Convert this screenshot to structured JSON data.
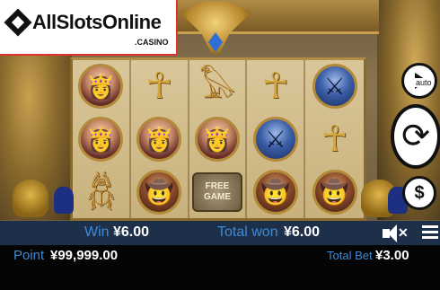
{
  "logo": {
    "text": "AllSlotsOnline",
    "sub": ".CASINO"
  },
  "reels": [
    [
      "queen",
      "ankh",
      "bird",
      "ankh",
      "warrior"
    ],
    [
      "queen",
      "queen",
      "queen",
      "warrior",
      "ankh"
    ],
    [
      "scarab-scroll",
      "explorer",
      "free",
      "explorer",
      "explorer"
    ]
  ],
  "free_symbol": {
    "line1": "FREE",
    "line2": "GAME"
  },
  "buttons": {
    "auto_label": "auto",
    "spin_icon": "refresh-icon",
    "bet_icon": "dollar-icon",
    "bet_glyph": "$"
  },
  "win_bar": {
    "win_label": "Win",
    "win_value": "¥6.00",
    "total_won_label": "Total won",
    "total_won_value": "¥6.00",
    "sound_icon": "speaker-muted-icon",
    "menu_icon": "hamburger-menu-icon"
  },
  "stats_bar": {
    "point_label": "Point",
    "point_value": "¥99,999.00",
    "total_bet_label": "Total Bet",
    "total_bet_value": "¥3.00"
  },
  "colors": {
    "label_blue": "#3e8ad8",
    "win_bar_bg": "#1e3049",
    "stats_bar_bg": "#050505"
  }
}
